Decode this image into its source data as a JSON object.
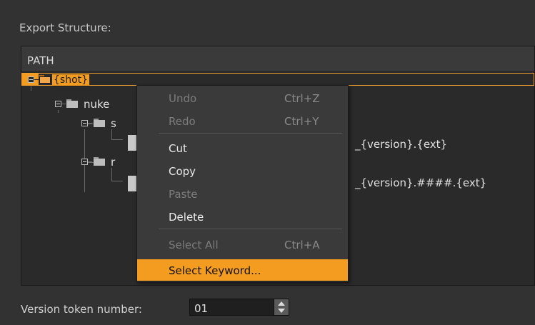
{
  "header": {
    "title": "Export Structure:"
  },
  "tree": {
    "column_header": "PATH",
    "nodes": [
      {
        "label": "{shot}",
        "selected": true
      },
      {
        "label": "nuke"
      },
      {
        "label": "s"
      },
      {
        "label": "_{version}.{ext}"
      },
      {
        "label": "r"
      },
      {
        "label": "_{version}.####.{ext}"
      }
    ]
  },
  "context_menu": {
    "items": [
      {
        "label": "Undo",
        "shortcut": "Ctrl+Z",
        "enabled": false
      },
      {
        "label": "Redo",
        "shortcut": "Ctrl+Y",
        "enabled": false
      },
      {
        "label": "Cut",
        "shortcut": "",
        "enabled": true
      },
      {
        "label": "Copy",
        "shortcut": "",
        "enabled": true
      },
      {
        "label": "Paste",
        "shortcut": "",
        "enabled": false
      },
      {
        "label": "Delete",
        "shortcut": "",
        "enabled": true
      },
      {
        "label": "Select All",
        "shortcut": "Ctrl+A",
        "enabled": false
      },
      {
        "label": "Select Keyword...",
        "shortcut": "",
        "enabled": true,
        "highlighted": true
      }
    ]
  },
  "footer": {
    "version_label": "Version token number:",
    "version_value": "01"
  },
  "colors": {
    "accent": "#f39c1f",
    "background": "#323232",
    "panel": "#2a2a2a"
  },
  "icons": [
    "folder-icon",
    "file-icon",
    "collapse-icon",
    "spin-up-icon",
    "spin-down-icon"
  ]
}
